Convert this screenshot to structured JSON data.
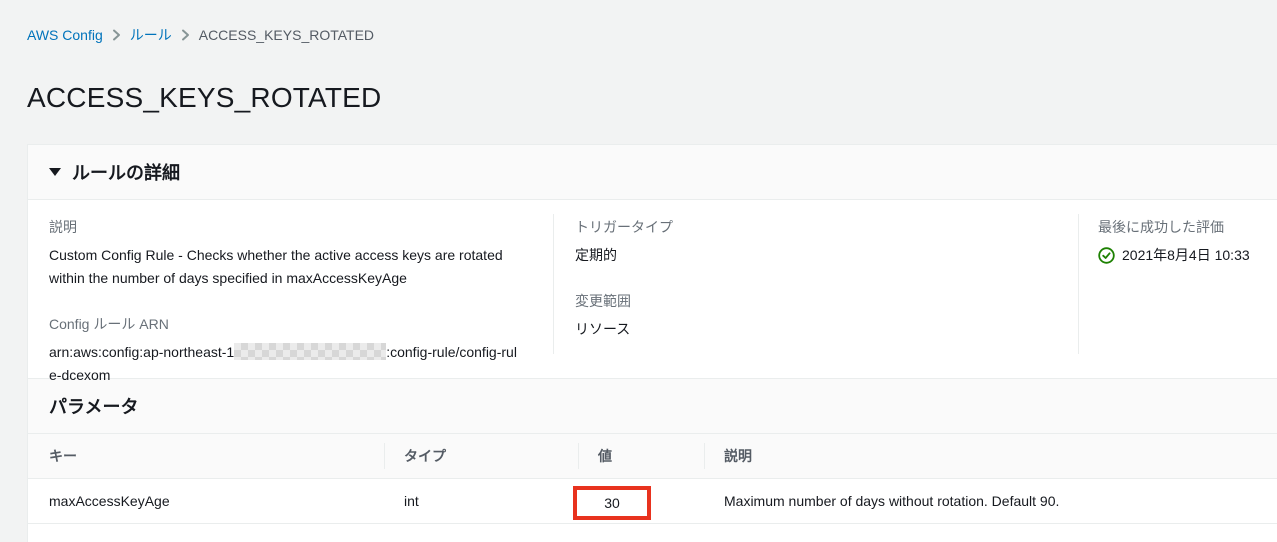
{
  "breadcrumb": {
    "items": [
      {
        "label": "AWS Config",
        "type": "link"
      },
      {
        "label": "ルール",
        "type": "link"
      },
      {
        "label": "ACCESS_KEYS_ROTATED",
        "type": "current"
      }
    ],
    "separator_icon": "chevron-right-icon"
  },
  "page": {
    "title": "ACCESS_KEYS_ROTATED"
  },
  "details": {
    "header": "ルールの詳細",
    "collapse_icon": "triangle-down-icon",
    "description_label": "説明",
    "description": "Custom Config Rule - Checks whether the active access keys are rotated within the number of days specified in maxAccessKeyAge",
    "arn_label": "Config ルール ARN",
    "arn_prefix": "arn:aws:config:ap-northeast-1",
    "arn_redacted": "account-id-hidden",
    "arn_suffix": ":config-rule/config-rule-dcexom",
    "trigger_label": "トリガータイプ",
    "trigger_value": "定期的",
    "scope_label": "変更範囲",
    "scope_value": "リソース",
    "last_eval_label": "最後に成功した評価",
    "last_eval_status_icon": "check-circle-icon",
    "last_eval_value": "2021年8月4日 10:33"
  },
  "parameters": {
    "title": "パラメータ",
    "columns": [
      "キー",
      "タイプ",
      "値",
      "説明"
    ],
    "rows": [
      {
        "key": "maxAccessKeyAge",
        "type": "int",
        "value": "30",
        "value_highlighted": true,
        "description": "Maximum number of days without rotation. Default 90."
      }
    ]
  },
  "colors": {
    "breadcrumb_link": "#0073bb",
    "success_green": "#1d8102",
    "highlight_red": "#e8321e",
    "page_background": "#f2f3f3",
    "band_background": "#fafafa",
    "border": "#eaeded"
  }
}
